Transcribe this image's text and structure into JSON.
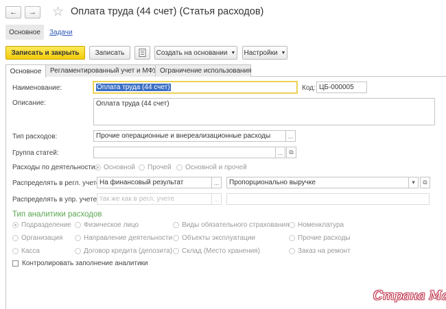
{
  "window": {
    "title": "Оплата труда (44 счет) (Статья расходов)"
  },
  "nav": {
    "back": "←",
    "forward": "→",
    "star": "☆"
  },
  "top_tabs": {
    "main": "Основное",
    "tasks": "Задачи"
  },
  "toolbar": {
    "save_close": "Записать и закрыть",
    "save": "Записать",
    "create_based": "Создать на основании",
    "settings": "Настройки",
    "caret": "▼"
  },
  "tabs": [
    "Основное",
    "Регламентированный учет и МФУ",
    "Ограничение использования"
  ],
  "form": {
    "name_label": "Наименование:",
    "name_value": "Оплата труда (44 счет)",
    "code_label": "Код:",
    "code_value": "ЦБ-000005",
    "desc_label": "Описание:",
    "desc_value": "Оплата труда (44 счет)",
    "expense_type_label": "Тип расходов:",
    "expense_type_value": "Прочие операционные и внереализационные расходы",
    "group_label": "Группа статей:",
    "group_value": "",
    "activity_label": "Расходы по деятельности:",
    "activity_options": [
      "Основной",
      "Прочей",
      "Основной и прочей"
    ],
    "reg_dist_label": "Распределять в регл. учете:",
    "reg_dist_value": "На финансовый результат",
    "reg_dist_method": "Пропорционально выручке",
    "mgmt_dist_label": "Распределять в упр. учете:",
    "mgmt_dist_placeholder": "так же как в регл. учете",
    "ellipsis": "...",
    "open_icon": "⧉",
    "dropdown_icon": "▾"
  },
  "analytics": {
    "title": "Тип аналитики расходов",
    "col1": [
      "Подразделение",
      "Организация",
      "Касса"
    ],
    "col2": [
      "Физическое лицо",
      "Направление деятельности",
      "Договор кредита (депозита)"
    ],
    "col3": [
      "Виды обязательного страхования",
      "Объекты эксплуатации",
      "Склад (Место хранения)"
    ],
    "col4": [
      "Номенклатура",
      "Прочие расходы",
      "Заказ на ремонт"
    ],
    "control_label": "Контролировать заполнение аналитики"
  },
  "watermark": "Страна Мам"
}
